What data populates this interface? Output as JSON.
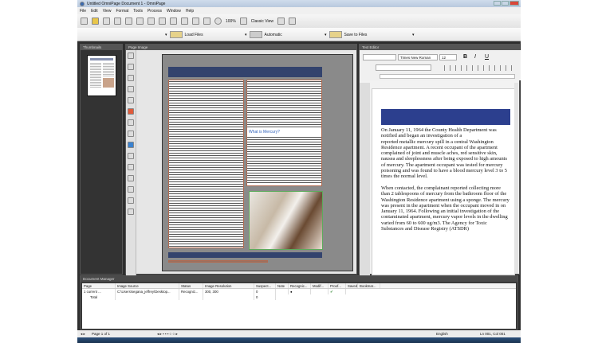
{
  "window": {
    "title": "Untitled OmniPage Document 1 - OmniPage"
  },
  "menu": [
    "File",
    "Edit",
    "View",
    "Format",
    "Tools",
    "Process",
    "Window",
    "Help"
  ],
  "toolbar": {
    "zoom": "100%",
    "view": "Classic View"
  },
  "workflow": {
    "load": "Load Files",
    "mode": "Automatic",
    "save": "Save to Files"
  },
  "panels": {
    "thumbnails": "Thumbnails",
    "page_image": "Page Image",
    "text_editor": "Text Editor",
    "document_manager": "Document Manager"
  },
  "editor": {
    "font": "Times New Roman",
    "size": "12",
    "bold": "B",
    "italic": "I",
    "underline": "U",
    "text": "On January 11, 1964 the County Health Department was notified and began an investigation of a\nreported metallic mercury spill in a central Washington Residence apartment. A recent occupant of the apartment complained of joint and muscle aches, red sensitive skin, nausea and sleeplessness after being exposed to high amounts of mercury. The apartment occupant was tested for mercury poisoning and was found to have a blood mercury level 3 to 5 times the normal level.\n\nWhen contacted, the complainant reported collecting more than 2 tablespoons of mercury from the bathroom floor of the Washington Residence apartment using a sponge. The mercury was present in the apartment when the occupant moved in on January 11, 1964. Following an initial investigation of the contaminated apartment, mercury vapor levels in the dwelling varied from 60 to 600 ug/m3. The Agency for Toxic Substances and Disease Registry (ATSDR)"
  },
  "page_image": {
    "heading": "What is Mercury?"
  },
  "document_manager": {
    "columns": [
      "Page",
      "Image Source",
      "Status",
      "Image Resolution",
      "Suspect...",
      "Note",
      "Recognic...",
      "Modif...",
      "Proof...",
      "Saved",
      "Bookmar..."
    ],
    "rows": [
      [
        "1 current ...",
        "C:\\Users\\segana_jeffrey\\Desktop...",
        "Recogniz...",
        "300, 300",
        "0",
        "",
        "",
        "",
        "",
        "",
        ""
      ],
      [
        "Total",
        "",
        "",
        "",
        "0",
        "",
        "",
        "",
        "",
        "",
        ""
      ]
    ]
  },
  "status": {
    "page": "Page 1 of 1",
    "language": "English",
    "position": "Ln 001, Col 001"
  },
  "colors": {
    "heading_bar": "#33436d",
    "zone_border": "#b06a50",
    "image_border": "#5cab5c"
  }
}
